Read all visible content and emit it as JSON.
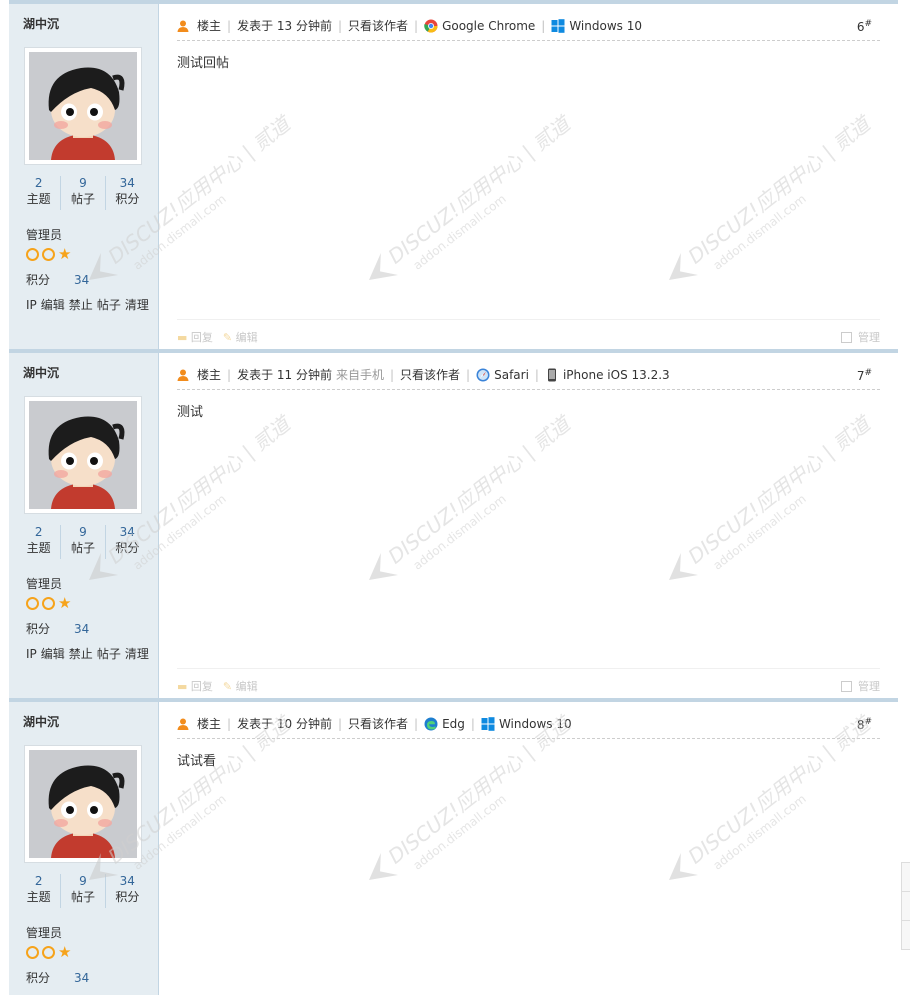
{
  "posts": [
    {
      "author": "湖中沉",
      "stats": [
        {
          "num": "2",
          "label": "主题"
        },
        {
          "num": "9",
          "label": "帖子"
        },
        {
          "num": "34",
          "label": "积分"
        }
      ],
      "group": "管理员",
      "points_label": "积分",
      "points_value": "34",
      "admin_links": [
        "IP",
        "编辑",
        "禁止",
        "帖子",
        "清理"
      ],
      "role": "楼主",
      "posted": "发表于 13 分钟前",
      "posted_extra": "",
      "only_author": "只看该作者",
      "browser": "Google Chrome",
      "browser_icon": "chrome-icon",
      "os": "Windows 10",
      "os_icon": "windows-icon",
      "floor": "6",
      "floor_sup": "#",
      "content": "测试回帖",
      "reply": "回复",
      "edit": "编辑",
      "manage": "管理"
    },
    {
      "author": "湖中沉",
      "stats": [
        {
          "num": "2",
          "label": "主题"
        },
        {
          "num": "9",
          "label": "帖子"
        },
        {
          "num": "34",
          "label": "积分"
        }
      ],
      "group": "管理员",
      "points_label": "积分",
      "points_value": "34",
      "admin_links": [
        "IP",
        "编辑",
        "禁止",
        "帖子",
        "清理"
      ],
      "role": "楼主",
      "posted": "发表于 11 分钟前",
      "posted_extra": "来自手机",
      "only_author": "只看该作者",
      "browser": "Safari",
      "browser_icon": "safari-icon",
      "os": "iPhone iOS 13.2.3",
      "os_icon": "phone-icon",
      "floor": "7",
      "floor_sup": "#",
      "content": "测试",
      "reply": "回复",
      "edit": "编辑",
      "manage": "管理"
    },
    {
      "author": "湖中沉",
      "stats": [
        {
          "num": "2",
          "label": "主题"
        },
        {
          "num": "9",
          "label": "帖子"
        },
        {
          "num": "34",
          "label": "积分"
        }
      ],
      "group": "管理员",
      "points_label": "积分",
      "points_value": "34",
      "admin_links": [],
      "role": "楼主",
      "posted": "发表于 10 分钟前",
      "posted_extra": "",
      "only_author": "只看该作者",
      "browser": "Edg",
      "browser_icon": "edge-icon",
      "os": "Windows 10",
      "os_icon": "windows-icon",
      "floor": "8",
      "floor_sup": "#",
      "content": "试试看",
      "reply": "",
      "edit": "",
      "manage": ""
    }
  ],
  "watermark": {
    "brand": "DISCUZ!应用中心 | 贰道",
    "url": "addon.dismall.com"
  },
  "colors": {
    "accent": "#336699",
    "sidebar": "#e5edf2",
    "border": "#c2d5e3",
    "star": "#f6a31b"
  }
}
